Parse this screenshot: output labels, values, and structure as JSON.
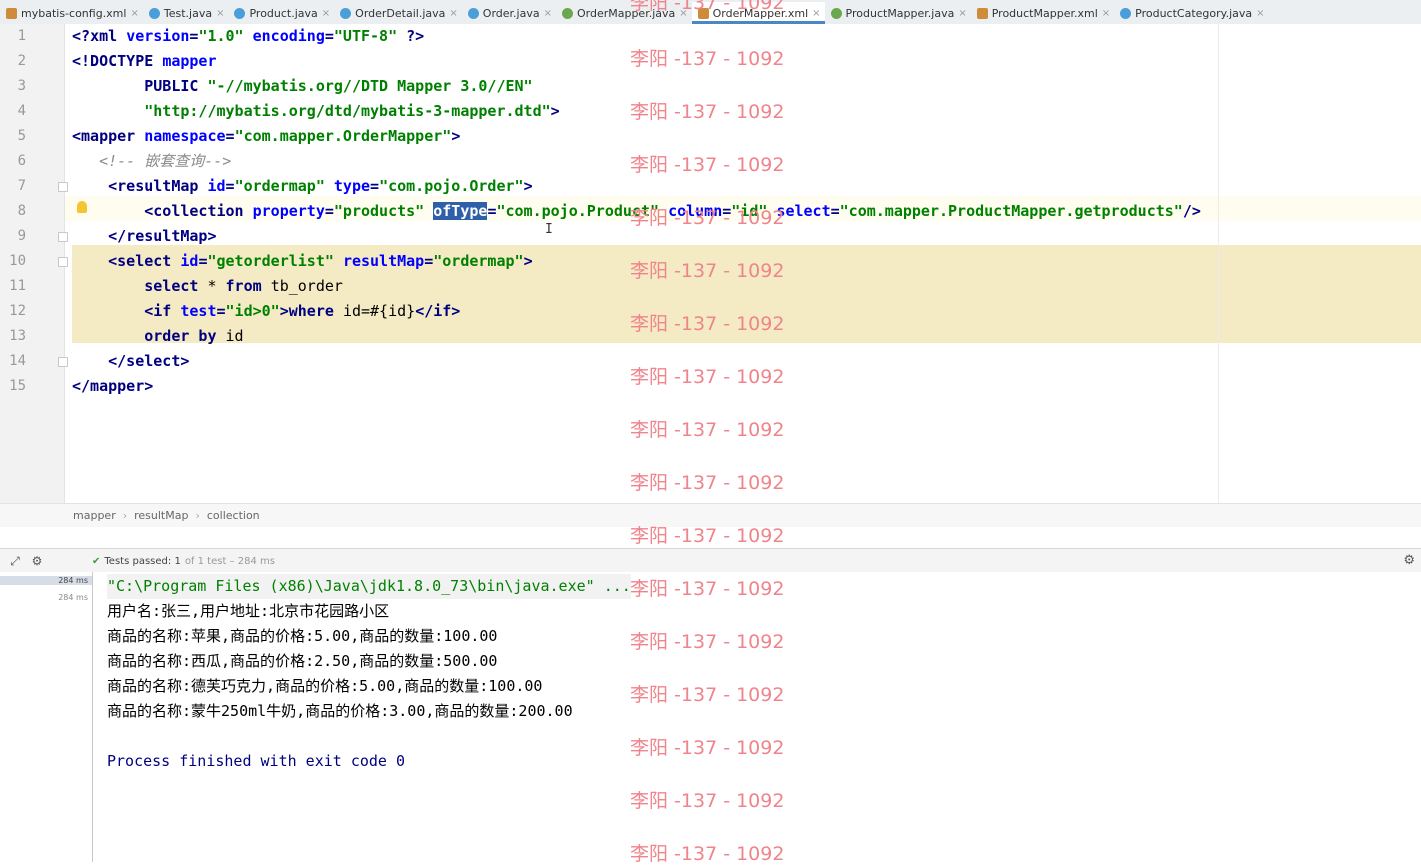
{
  "tabs": [
    {
      "label": "mybatis-config.xml",
      "icon": "xml-file-icon",
      "kind": "xml"
    },
    {
      "label": "Test.java",
      "icon": "java-class-icon",
      "kind": "java"
    },
    {
      "label": "Product.java",
      "icon": "java-class-icon",
      "kind": "java"
    },
    {
      "label": "OrderDetail.java",
      "icon": "java-class-icon",
      "kind": "java"
    },
    {
      "label": "Order.java",
      "icon": "java-class-icon",
      "kind": "java"
    },
    {
      "label": "OrderMapper.java",
      "icon": "java-interface-icon",
      "kind": "iface"
    },
    {
      "label": "OrderMapper.xml",
      "icon": "xml-file-icon",
      "kind": "xml",
      "active": true
    },
    {
      "label": "ProductMapper.java",
      "icon": "java-interface-icon",
      "kind": "iface"
    },
    {
      "label": "ProductMapper.xml",
      "icon": "xml-file-icon",
      "kind": "xml"
    },
    {
      "label": "ProductCategory.java",
      "icon": "java-class-icon",
      "kind": "java"
    }
  ],
  "close_glyph": "×",
  "editor": {
    "line_numbers": [
      "1",
      "2",
      "3",
      "4",
      "5",
      "6",
      "7",
      "8",
      "9",
      "10",
      "11",
      "12",
      "13",
      "14",
      "15"
    ],
    "lines": [
      [
        {
          "t": "<?",
          "c": "tag"
        },
        {
          "t": "xml ",
          "c": "tag"
        },
        {
          "t": "version",
          "c": "attr"
        },
        {
          "t": "=",
          "c": "tag"
        },
        {
          "t": "\"1.0\"",
          "c": "val"
        },
        {
          "t": " ",
          "c": "tag"
        },
        {
          "t": "encoding",
          "c": "attr"
        },
        {
          "t": "=",
          "c": "tag"
        },
        {
          "t": "\"UTF-8\"",
          "c": "val"
        },
        {
          "t": " ?>",
          "c": "tag"
        }
      ],
      [
        {
          "t": "<!DOCTYPE ",
          "c": "tag"
        },
        {
          "t": "mapper",
          "c": "attr"
        }
      ],
      [
        {
          "t": "        PUBLIC ",
          "c": "tag"
        },
        {
          "t": "\"-//mybatis.org//DTD Mapper 3.0//EN\"",
          "c": "val"
        }
      ],
      [
        {
          "t": "        ",
          "c": "tag"
        },
        {
          "t": "\"http://mybatis.org/dtd/mybatis-3-mapper.dtd\"",
          "c": "val"
        },
        {
          "t": ">",
          "c": "tag"
        }
      ],
      [
        {
          "t": "<mapper ",
          "c": "tag"
        },
        {
          "t": "namespace",
          "c": "attr"
        },
        {
          "t": "=",
          "c": "tag"
        },
        {
          "t": "\"com.mapper.OrderMapper\"",
          "c": "val"
        },
        {
          "t": ">",
          "c": "tag"
        }
      ],
      [
        {
          "t": "   <!-- 嵌套查询-->",
          "c": "cmt"
        }
      ],
      [
        {
          "t": "    <resultMap ",
          "c": "tag"
        },
        {
          "t": "id",
          "c": "attr"
        },
        {
          "t": "=",
          "c": "tag"
        },
        {
          "t": "\"ordermap\"",
          "c": "val"
        },
        {
          "t": " ",
          "c": "tag"
        },
        {
          "t": "type",
          "c": "attr"
        },
        {
          "t": "=",
          "c": "tag"
        },
        {
          "t": "\"com.pojo.Order\"",
          "c": "val"
        },
        {
          "t": ">",
          "c": "tag"
        }
      ],
      [
        {
          "t": "        <collection ",
          "c": "tag"
        },
        {
          "t": "property",
          "c": "attr"
        },
        {
          "t": "=",
          "c": "tag"
        },
        {
          "t": "\"products\"",
          "c": "val"
        },
        {
          "t": " ",
          "c": "tag"
        },
        {
          "t": "ofType",
          "c": "selword"
        },
        {
          "t": "=",
          "c": "tag"
        },
        {
          "t": "\"com.pojo.Product\"",
          "c": "val"
        },
        {
          "t": " ",
          "c": "tag"
        },
        {
          "t": "column",
          "c": "attr"
        },
        {
          "t": "=",
          "c": "tag"
        },
        {
          "t": "\"id\"",
          "c": "val"
        },
        {
          "t": " ",
          "c": "tag"
        },
        {
          "t": "select",
          "c": "attr"
        },
        {
          "t": "=",
          "c": "tag"
        },
        {
          "t": "\"com.mapper.ProductMapper.getproducts\"",
          "c": "val"
        },
        {
          "t": "/>",
          "c": "tag"
        }
      ],
      [
        {
          "t": "    </resultMap>",
          "c": "tag"
        }
      ],
      [
        {
          "t": "    <select ",
          "c": "tag"
        },
        {
          "t": "id",
          "c": "attr"
        },
        {
          "t": "=",
          "c": "tag"
        },
        {
          "t": "\"getorderlist\"",
          "c": "val"
        },
        {
          "t": " ",
          "c": "tag"
        },
        {
          "t": "resultMap",
          "c": "attr"
        },
        {
          "t": "=",
          "c": "tag"
        },
        {
          "t": "\"ordermap\"",
          "c": "val"
        },
        {
          "t": ">",
          "c": "tag"
        }
      ],
      [
        {
          "t": "        select ",
          "c": "tag"
        },
        {
          "t": "* ",
          "c": "txt"
        },
        {
          "t": "from ",
          "c": "tag"
        },
        {
          "t": "tb_order",
          "c": "txt"
        }
      ],
      [
        {
          "t": "        <if ",
          "c": "tag"
        },
        {
          "t": "test",
          "c": "attr"
        },
        {
          "t": "=",
          "c": "tag"
        },
        {
          "t": "\"id>0\"",
          "c": "val"
        },
        {
          "t": ">",
          "c": "tag"
        },
        {
          "t": "where ",
          "c": "tag"
        },
        {
          "t": "id=#{id}",
          "c": "txt"
        },
        {
          "t": "</if>",
          "c": "tag"
        }
      ],
      [
        {
          "t": "        order by ",
          "c": "tag"
        },
        {
          "t": "id",
          "c": "txt"
        }
      ],
      [
        {
          "t": "    </select>",
          "c": "tag"
        }
      ],
      [
        {
          "t": "</mapper>",
          "c": "tag"
        }
      ]
    ],
    "text_cursor_glyph": "I"
  },
  "breadcrumb": [
    "mapper",
    "resultMap",
    "collection"
  ],
  "breadcrumb_sep": "›",
  "run": {
    "status_check": "✔",
    "status_label": "Tests passed:",
    "status_count": "1",
    "status_detail": "of 1 test – 284 ms",
    "timings": [
      "284 ms",
      "284 ms"
    ],
    "console": [
      {
        "text": "\"C:\\Program Files (x86)\\Java\\jdk1.8.0_73\\bin\\java.exe\" ...",
        "kind": "cmd"
      },
      {
        "text": "用户名:张三,用户地址:北京市花园路小区",
        "kind": "out"
      },
      {
        "text": "商品的名称:苹果,商品的价格:5.00,商品的数量:100.00",
        "kind": "out"
      },
      {
        "text": "商品的名称:西瓜,商品的价格:2.50,商品的数量:500.00",
        "kind": "out"
      },
      {
        "text": "商品的名称:德芙巧克力,商品的价格:5.00,商品的数量:100.00",
        "kind": "out"
      },
      {
        "text": "商品的名称:蒙牛250ml牛奶,商品的价格:3.00,商品的数量:200.00",
        "kind": "out"
      },
      {
        "text": "",
        "kind": "out"
      },
      {
        "text": "Process finished with exit code 0",
        "kind": "proc"
      }
    ]
  },
  "watermark": "李阳 -137 - 1092"
}
